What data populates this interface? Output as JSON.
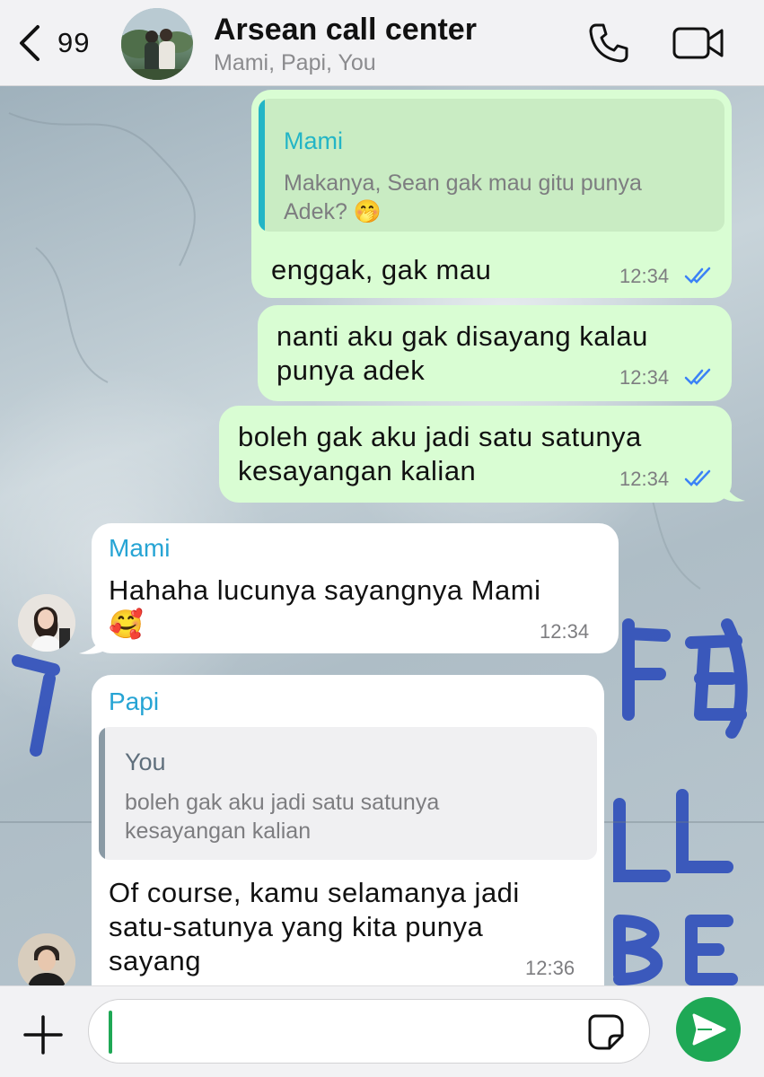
{
  "header": {
    "back_count": "99",
    "title": "Arsean call center",
    "subtitle": "Mami, Papi, You"
  },
  "messages": [
    {
      "direction": "outgoing",
      "quote": {
        "name": "Mami",
        "lines": [
          "Makanya, Sean gak mau gitu punya",
          "Adek? 🤭"
        ]
      },
      "lines": [
        "enggak, gak mau"
      ],
      "time": "12:34"
    },
    {
      "direction": "outgoing",
      "lines": [
        "nanti aku gak disayang kalau",
        "punya adek"
      ],
      "time": "12:34"
    },
    {
      "direction": "outgoing",
      "lines": [
        "boleh gak aku jadi satu satunya",
        "kesayangan kalian"
      ],
      "time": "12:34"
    },
    {
      "direction": "incoming",
      "sender": "Mami",
      "lines": [
        "Hahaha lucunya sayangnya Mami",
        "🥰"
      ],
      "time": "12:34"
    },
    {
      "direction": "incoming",
      "sender": "Papi",
      "quote": {
        "name": "You",
        "lines": [
          "boleh gak aku jadi satu satunya",
          "kesayangan kalian"
        ]
      },
      "lines": [
        "Of course, kamu selamanya jadi",
        "satu-satunya yang kita punya",
        "sayang"
      ],
      "time": "12:36"
    }
  ],
  "input": {
    "value": "",
    "placeholder": ""
  },
  "colors": {
    "outgoing_bubble": "#d9fdd3",
    "incoming_bubble": "#ffffff",
    "sender_name": "#26a4d4",
    "read_ticks": "#3b82f6",
    "send_button": "#1ea855"
  },
  "icons": [
    "chevron-left-icon",
    "phone-icon",
    "video-camera-icon",
    "plus-icon",
    "sticker-icon",
    "send-icon",
    "double-check-icon"
  ]
}
